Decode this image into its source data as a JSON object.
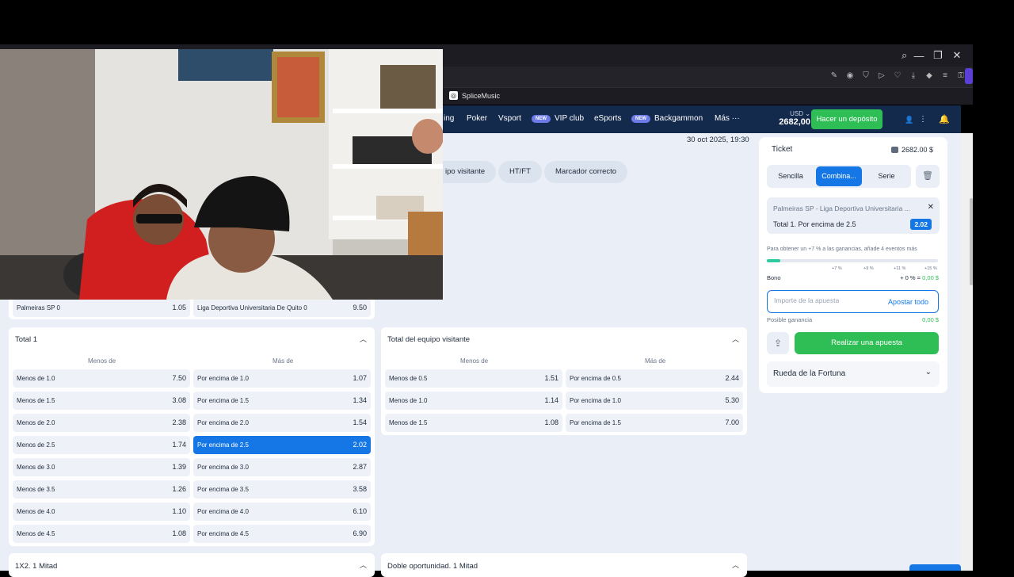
{
  "browser": {
    "bookmark": "SpliceMusic"
  },
  "nav": {
    "items": [
      {
        "label": "ing",
        "new": false
      },
      {
        "label": "Poker",
        "new": false
      },
      {
        "label": "Vsport",
        "new": false
      },
      {
        "label": "VIP club",
        "new": true
      },
      {
        "label": "eSports",
        "new": false
      },
      {
        "label": "Backgammon",
        "new": true
      },
      {
        "label": "Más ···",
        "new": false
      }
    ],
    "new_badge": "NEW",
    "currency": "USD ⌄",
    "balance": "2682,00",
    "deposit": "Hacer un depósito"
  },
  "event": {
    "date": "30 oct 2025, 19:30",
    "pills": [
      "ipo visitante",
      "HT/FT",
      "Marcador correcto"
    ]
  },
  "score_row": {
    "home": {
      "label": "Palmeiras SP 0",
      "odd": "1.05"
    },
    "away": {
      "label": "Liga Deportiva Universitaria De Quito 0",
      "odd": "9.50"
    }
  },
  "total1": {
    "title": "Total 1",
    "col_under": "Menos de",
    "col_over": "Más de",
    "rows": [
      {
        "u": "Menos de 1.0",
        "uo": "7.50",
        "o": "Por encima de 1.0",
        "oo": "1.07"
      },
      {
        "u": "Menos de 1.5",
        "uo": "3.08",
        "o": "Por encima de 1.5",
        "oo": "1.34"
      },
      {
        "u": "Menos de 2.0",
        "uo": "2.38",
        "o": "Por encima de 2.0",
        "oo": "1.54"
      },
      {
        "u": "Menos de 2.5",
        "uo": "1.74",
        "o": "Por encima de 2.5",
        "oo": "2.02"
      },
      {
        "u": "Menos de 3.0",
        "uo": "1.39",
        "o": "Por encima de 3.0",
        "oo": "2.87"
      },
      {
        "u": "Menos de 3.5",
        "uo": "1.26",
        "o": "Por encima de 3.5",
        "oo": "3.58"
      },
      {
        "u": "Menos de 4.0",
        "uo": "1.10",
        "o": "Por encima de 4.0",
        "oo": "6.10"
      },
      {
        "u": "Menos de 4.5",
        "uo": "1.08",
        "o": "Por encima de 4.5",
        "oo": "6.90"
      }
    ]
  },
  "away_total": {
    "title": "Total del equipo visitante",
    "col_under": "Menos de",
    "col_over": "Más de",
    "rows": [
      {
        "u": "Menos de 0.5",
        "uo": "1.51",
        "o": "Por encima de 0.5",
        "oo": "2.44"
      },
      {
        "u": "Menos de 1.0",
        "uo": "1.14",
        "o": "Por encima de 1.0",
        "oo": "5.30"
      },
      {
        "u": "Menos de 1.5",
        "uo": "1.08",
        "o": "Por encima de 1.5",
        "oo": "7.00"
      }
    ]
  },
  "bottom_cards": {
    "left": "1X2. 1 Mitad",
    "right": "Doble oportunidad. 1 Mitad"
  },
  "ticket": {
    "title": "Ticket",
    "balance": "2682.00 $",
    "tabs": [
      "Sencilla",
      "Combina...",
      "Serie"
    ],
    "active_tab": "Combina...",
    "match": "Palmeiras SP - Liga Deportiva Universitaria ...",
    "pick": "Total 1. Por encima de 2.5",
    "odd": "2.02",
    "promo": "Para obtener un +7 % a las ganancias, añade 4 eventos más",
    "progress_fraction": 0.08,
    "pcts": [
      "+7 %",
      "+9 %",
      "+11 %",
      "+15 %"
    ],
    "bono_label": "Bono",
    "bono_prefix": "+ 0 % = ",
    "bono_value": "0,00 $",
    "amount_placeholder": "Importe de la apuesta",
    "bet_all": "Apostar todo",
    "gain_label": "Posible ganancia",
    "gain_value": "0,00 $",
    "place_bet": "Realizar una apuesta",
    "fortune": "Rueda de la Fortuna"
  },
  "colors": {
    "nav_bg": "#142a4d",
    "accent_blue": "#1577e6",
    "green": "#2fbe55",
    "page_bg": "#eaeff7"
  }
}
